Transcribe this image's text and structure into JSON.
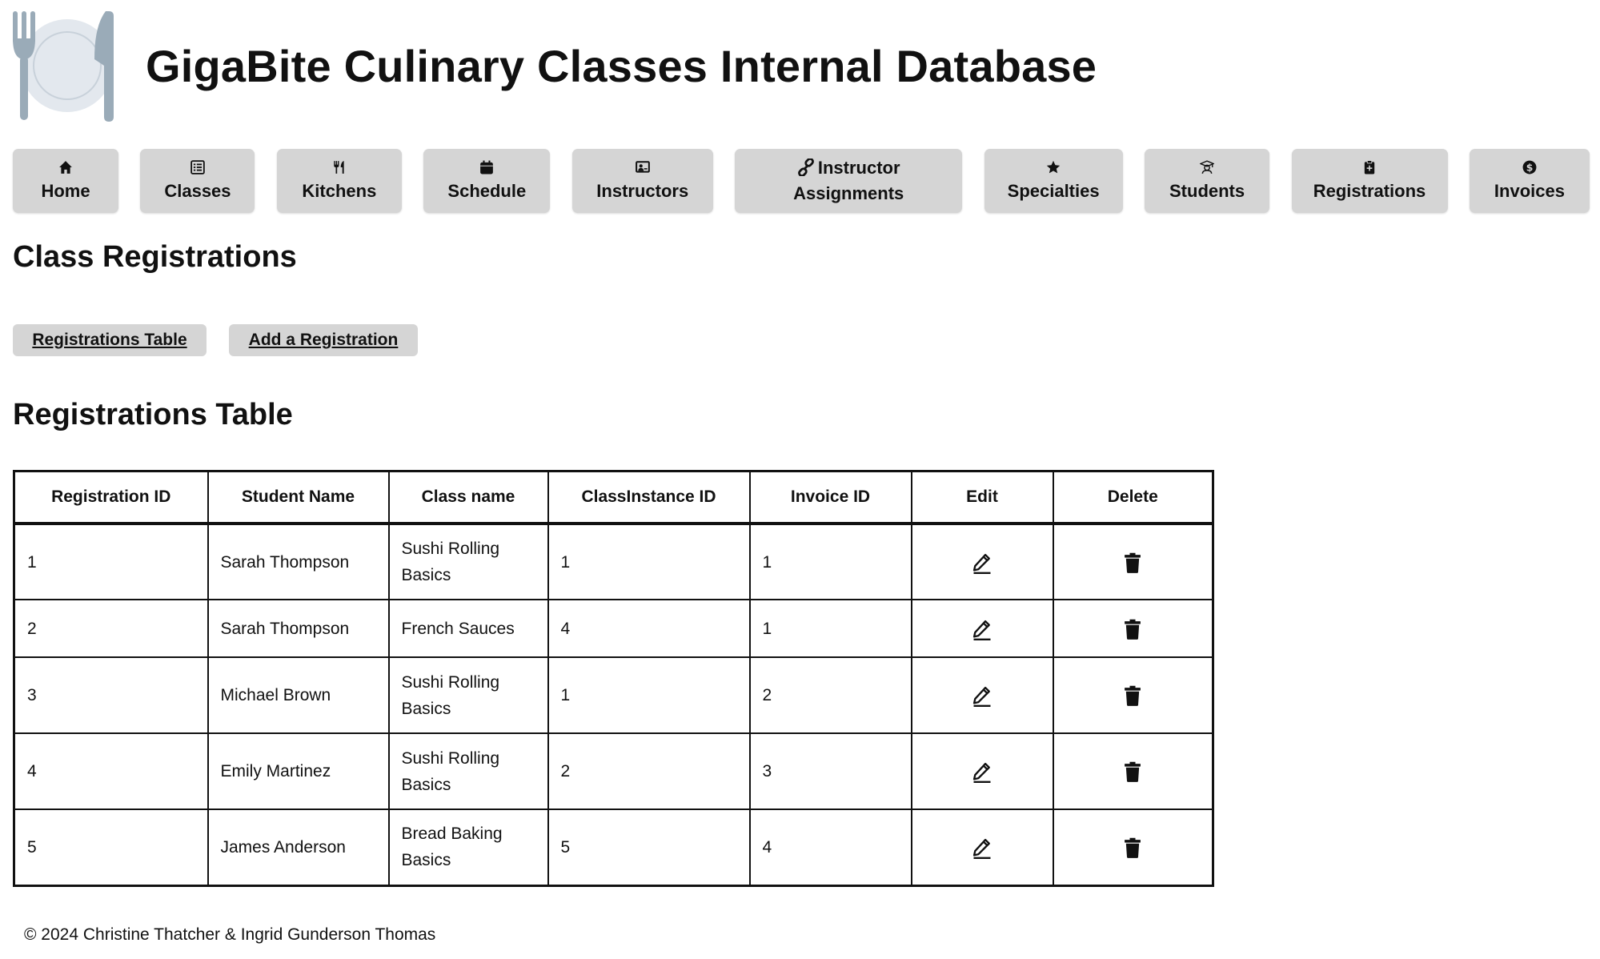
{
  "app": {
    "title": "GigaBite Culinary Classes Internal Database"
  },
  "nav": {
    "items": [
      {
        "label": "Home",
        "icon": "home-icon"
      },
      {
        "label": "Classes",
        "icon": "list-icon"
      },
      {
        "label": "Kitchens",
        "icon": "utensils-icon"
      },
      {
        "label": "Schedule",
        "icon": "calendar-icon"
      },
      {
        "label": "Instructors",
        "icon": "chalkboard-icon"
      },
      {
        "label_line1": "Instructor",
        "label_line2": "Assignments",
        "icon": "link-icon"
      },
      {
        "label": "Specialties",
        "icon": "star-icon"
      },
      {
        "label": "Students",
        "icon": "student-icon"
      },
      {
        "label": "Registrations",
        "icon": "clipboard-icon"
      },
      {
        "label": "Invoices",
        "icon": "dollar-icon"
      }
    ]
  },
  "page": {
    "title": "Class Registrations",
    "buttons": {
      "table_label": "Registrations Table",
      "add_label": "Add a Registration"
    },
    "section_title": "Registrations Table"
  },
  "table": {
    "headers": [
      "Registration ID",
      "Student Name",
      "Class name",
      "ClassInstance ID",
      "Invoice ID",
      "Edit",
      "Delete"
    ],
    "rows": [
      {
        "id": "1",
        "student": "Sarah Thompson",
        "class_line1": "Sushi Rolling",
        "class_line2": "Basics",
        "instance": "1",
        "invoice": "1"
      },
      {
        "id": "2",
        "student": "Sarah Thompson",
        "class_line1": "French Sauces",
        "class_line2": "",
        "instance": "4",
        "invoice": "1"
      },
      {
        "id": "3",
        "student": "Michael Brown",
        "class_line1": "Sushi Rolling",
        "class_line2": "Basics",
        "instance": "1",
        "invoice": "2"
      },
      {
        "id": "4",
        "student": "Emily Martinez",
        "class_line1": "Sushi Rolling",
        "class_line2": "Basics",
        "instance": "2",
        "invoice": "3"
      },
      {
        "id": "5",
        "student": "James Anderson",
        "class_line1": "Bread Baking",
        "class_line2": "Basics",
        "instance": "5",
        "invoice": "4"
      }
    ]
  },
  "footer": {
    "text": "© 2024 Christine Thatcher & Ingrid Gunderson Thomas"
  },
  "colors": {
    "button_bg": "#d5d5d5",
    "logo_plate": "#e3e8ee",
    "logo_cutlery": "#9aabb8"
  }
}
